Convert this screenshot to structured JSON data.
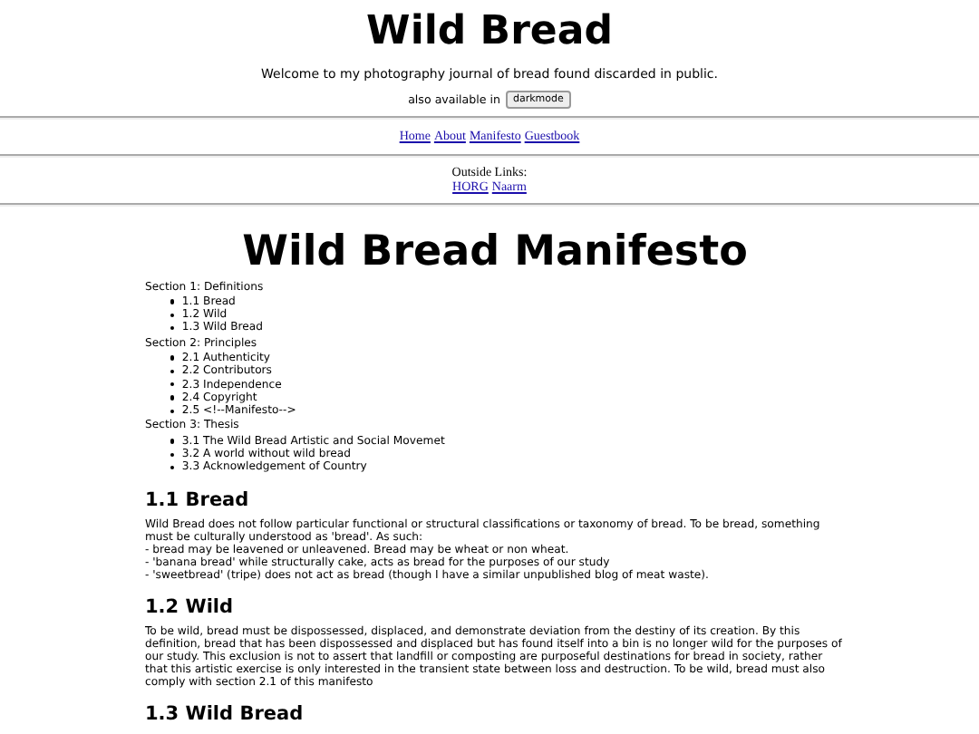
{
  "header": {
    "title": "Wild Bread",
    "welcome": "Welcome to my photography journal of bread found discarded in public.",
    "also_text": "also available in",
    "mode_button": "darkmode"
  },
  "nav": {
    "links": [
      "Home",
      "About",
      "Manifesto",
      "Guestbook"
    ]
  },
  "outside": {
    "label": "Outside Links:",
    "links": [
      "HORG",
      "Naarm"
    ]
  },
  "manifesto": {
    "title": "Wild Bread Manifesto",
    "toc": [
      {
        "title": "Section 1: Definitions",
        "items": [
          "1.1 Bread",
          "1.2 Wild",
          "1.3 Wild Bread"
        ]
      },
      {
        "title": "Section 2: Principles",
        "items": [
          "2.1 Authenticity",
          "2.2 Contributors",
          "2.3 Independence",
          "2.4 Copyright",
          "2.5 <!--Manifesto-->"
        ]
      },
      {
        "title": "Section 3: Thesis",
        "items": [
          "3.1 The Wild Bread Artistic and Social Movemet",
          "3.2 A world without wild bread",
          "3.3 Acknowledgement of Country"
        ]
      }
    ],
    "sections": [
      {
        "heading": "1.1 Bread",
        "paragraphs": [
          "Wild Bread does not follow particular functional or structural classifications or taxonomy of bread. To be bread, something must be culturally understood as 'bread'. As such:",
          "- bread may be leavened or unleavened. Bread may be wheat or non wheat.",
          "- 'banana bread' while structurally cake, acts as bread for the purposes of our study",
          "- 'sweetbread' (tripe) does not act as bread (though I have a similar unpublished blog of meat waste)."
        ]
      },
      {
        "heading": "1.2 Wild",
        "paragraphs": [
          "To be wild, bread must be dispossessed, displaced, and demonstrate deviation from the destiny of its creation. By this definition, bread that has been dispossessed and displaced but has found itself into a bin is no longer wild for the purposes of our study. This exclusion is not to assert that landfill or composting are purposeful destinations for bread in society, rather that this artistic exercise is only interested in the transient state between loss and destruction. To be wild, bread must also comply with section 2.1 of this manifesto"
        ]
      },
      {
        "heading": "1.3 Wild Bread"
      }
    ]
  }
}
